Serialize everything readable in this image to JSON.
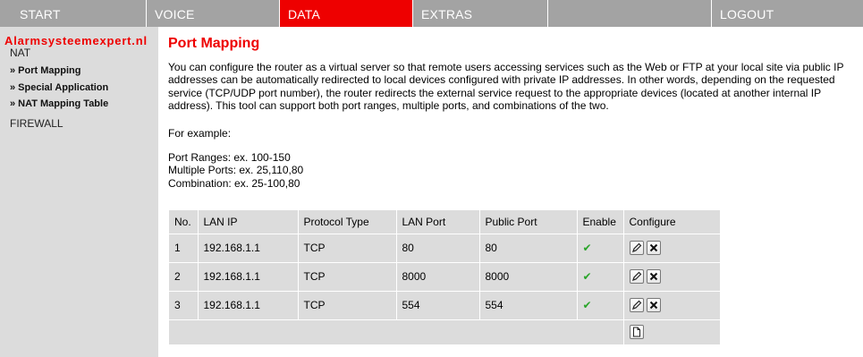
{
  "topnav": {
    "tabs": [
      {
        "label": "START"
      },
      {
        "label": "VOICE"
      },
      {
        "label": "DATA"
      },
      {
        "label": "EXTRAS"
      },
      {
        "label": ""
      },
      {
        "label": "LOGOUT"
      }
    ],
    "accent_color": "#ee0000"
  },
  "sidebar": {
    "brand": "Alarmsysteemexpert.nl",
    "section": "NAT",
    "items": [
      {
        "label": "» Port Mapping"
      },
      {
        "label": "» Special Application"
      },
      {
        "label": "» NAT Mapping Table"
      }
    ],
    "firewall": "FIREWALL"
  },
  "main": {
    "title": "Port Mapping",
    "description": "You can configure the router as a virtual server so that remote users accessing services such as the Web or FTP at your local site via public IP addresses can be automatically redirected to local devices configured with private IP addresses. In other words, depending on the requested service (TCP/UDP port number), the router redirects the external service request to the appropriate devices (located at another internal IP address). This tool can support both port ranges, multiple ports, and combinations of the two.",
    "example_heading": "For example:",
    "examples": [
      "Port Ranges: ex. 100-150",
      "Multiple Ports: ex. 25,110,80",
      "Combination: ex. 25-100,80"
    ]
  },
  "table": {
    "headers": [
      "No.",
      "LAN IP",
      "Protocol Type",
      "LAN Port",
      "Public Port",
      "Enable",
      "Configure"
    ],
    "rows": [
      {
        "no": "1",
        "lan_ip": "192.168.1.1",
        "protocol": "TCP",
        "lan_port": "80",
        "public_port": "80",
        "enable": "✔"
      },
      {
        "no": "2",
        "lan_ip": "192.168.1.1",
        "protocol": "TCP",
        "lan_port": "8000",
        "public_port": "8000",
        "enable": "✔"
      },
      {
        "no": "3",
        "lan_ip": "192.168.1.1",
        "protocol": "TCP",
        "lan_port": "554",
        "public_port": "554",
        "enable": "✔"
      }
    ],
    "icons": {
      "edit": "edit-icon",
      "delete": "delete-icon",
      "add": "add-new-icon"
    },
    "enabled_color": "#2aa52a"
  }
}
